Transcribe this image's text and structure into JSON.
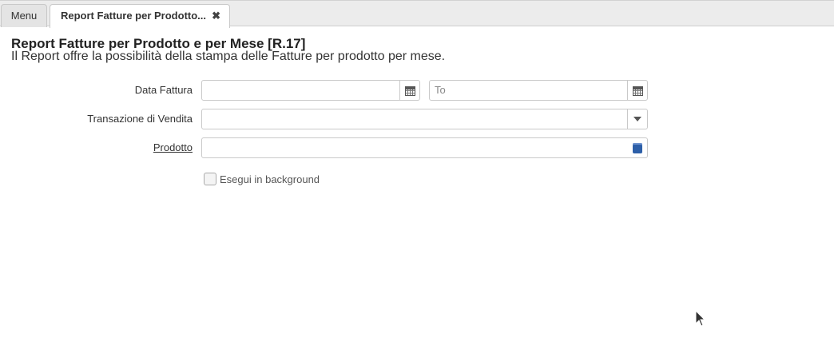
{
  "tabs": {
    "menu_label": "Menu",
    "active_label": "Report Fatture per Prodotto...",
    "close_glyph": "✖"
  },
  "header": {
    "title": "Report Fatture per Prodotto e per Mese [R.17]",
    "description": "Il Report offre la possibilità della stampa delle Fatture per prodotto per mese."
  },
  "form": {
    "data_fattura_label": "Data Fattura",
    "data_fattura_from": "",
    "data_fattura_to": "",
    "data_fattura_to_placeholder": "To",
    "transazione_label": "Transazione di Vendita",
    "transazione_value": "",
    "prodotto_label": "Prodotto",
    "prodotto_value": "",
    "background_label": "Esegui in background",
    "background_checked": false
  },
  "icons": {
    "calendar": "calendar-icon",
    "dropdown": "chevron-down-icon",
    "product": "product-search-icon",
    "cursor": "mouse-pointer-icon"
  },
  "colors": {
    "product_icon": "#2d5fa8",
    "tabbar_bg": "#ececec"
  }
}
